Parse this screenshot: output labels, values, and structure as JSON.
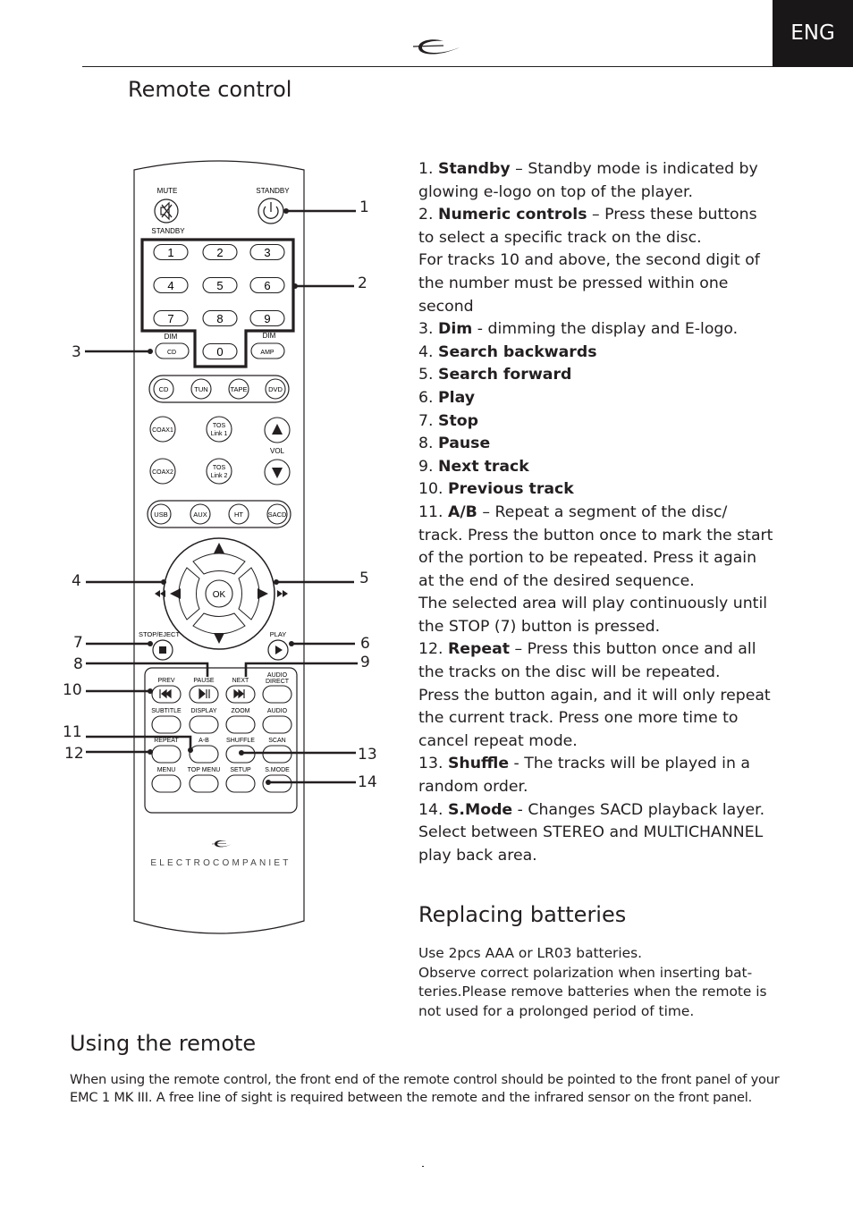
{
  "header": {
    "language_tab": "ENG",
    "logo_icon": "electrocompaniet-e-logo"
  },
  "sections": {
    "remote_title": "Remote control",
    "batteries_title": "Replacing batteries",
    "using_title": "Using the remote"
  },
  "descriptions": [
    {
      "num": "1.",
      "title": "Standby",
      "text": " – Standby mode is indicated by glowing e-logo on top of the player."
    },
    {
      "num": "2.",
      "title": "Numeric controls",
      "text": " – Press these buttons to select a specific track on the disc."
    },
    {
      "num": "",
      "title": "",
      "text": "For tracks 10 and above, the second digit of the number must be pressed within one second"
    },
    {
      "num": "3.",
      "title": "Dim",
      "text": " - dimming the display and E-logo."
    },
    {
      "num": "4.",
      "title": "Search backwards",
      "text": ""
    },
    {
      "num": "5.",
      "title": "Search forward",
      "text": ""
    },
    {
      "num": "6.",
      "title": "Play",
      "text": ""
    },
    {
      "num": "7.",
      "title": "Stop",
      "text": ""
    },
    {
      "num": "8.",
      "title": "Pause",
      "text": ""
    },
    {
      "num": "9.",
      "title": "Next track",
      "text": ""
    },
    {
      "num": "10.",
      "title": "Previous track",
      "text": ""
    },
    {
      "num": "11.",
      "title": "A/B",
      "text": " – Repeat a segment of the disc/ track. Press the button once to mark the start of the portion to be repeated. Press it again at the end of the desired sequence."
    },
    {
      "num": "",
      "title": "",
      "text": "The selected area will play continuously until the STOP (7) button is pressed."
    },
    {
      "num": "12.",
      "title": "Repeat",
      "text": " – Press this button once and all the tracks on the disc will be repeated."
    },
    {
      "num": "",
      "title": "",
      "text": "Press the button again, and it will only repeat the current track. Press one more time to cancel repeat mode."
    },
    {
      "num": "13.",
      "title": "Shuffle",
      "text": " - The tracks will be played in a random order."
    },
    {
      "num": "14.",
      "title": "S.Mode",
      "text": " - Changes SACD playback layer. Select between STEREO and MULTICHANNEL play back area."
    }
  ],
  "batteries": [
    "Use 2pcs AAA or LR03 batteries.",
    "Observe correct polarization when inserting bat-teries.Please remove batteries when the remote is not used for a prolonged period of time."
  ],
  "using": "When using the remote control, the front end of the remote control should be pointed to the front panel of your EMC 1 MK III. A free line of sight is required between the remote and the infrared sensor on the front panel.",
  "remote": {
    "labels": {
      "mute": "MUTE",
      "standby": "STANDBY",
      "standby2": "STANDBY",
      "dim_left": "DIM",
      "dim_right": "DIM",
      "cd_small": "CD",
      "amp": "AMP",
      "vol": "VOL",
      "ok": "OK",
      "stop_eject": "STOP/EJECT",
      "play": "PLAY",
      "brand": "ELECTROCOMPANIET"
    },
    "numeric_keys": [
      "1",
      "2",
      "3",
      "4",
      "5",
      "6",
      "7",
      "8",
      "9",
      "0"
    ],
    "source_row1": [
      "CD",
      "TUN",
      "TAPE",
      "DVD"
    ],
    "coax1": "COAX1",
    "coax2": "COAX2",
    "tos1": [
      "TOS",
      "Link 1"
    ],
    "tos2": [
      "TOS",
      "Link 2"
    ],
    "source_row2": [
      "USB",
      "AUX",
      "HT",
      "SACD"
    ],
    "bottom_grid": [
      [
        "PREV",
        "PAUSE",
        "NEXT",
        "AUDIO DIRECT"
      ],
      [
        "SUBTITLE",
        "DISPLAY",
        "ZOOM",
        "AUDIO"
      ],
      [
        "REPEAT",
        "A-B",
        "SHUFFLE",
        "SCAN"
      ],
      [
        "MENU",
        "TOP MENU",
        "SETUP",
        "S.MODE"
      ]
    ],
    "callouts": [
      "1",
      "2",
      "3",
      "4",
      "5",
      "6",
      "7",
      "8",
      "9",
      "10",
      "11",
      "12",
      "13",
      "14"
    ]
  }
}
